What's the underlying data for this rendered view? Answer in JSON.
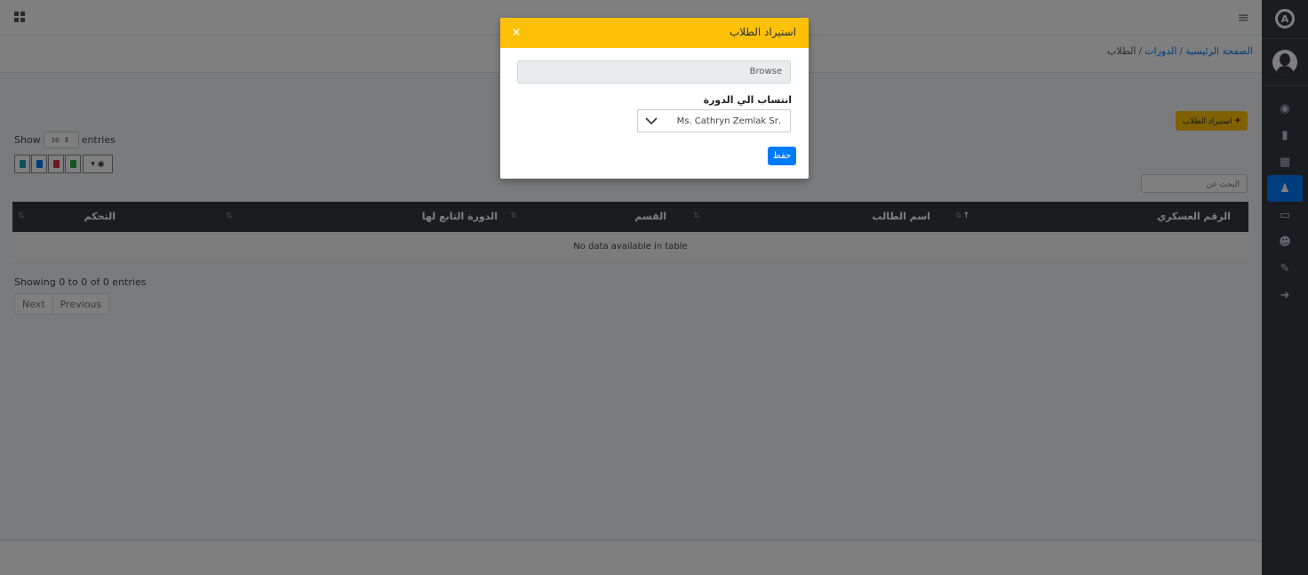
{
  "sidebar": {
    "logo_letter": "A",
    "items": [
      {
        "icon": "tachometer-icon",
        "glyph": "◉"
      },
      {
        "icon": "calendar-icon",
        "glyph": "▮"
      },
      {
        "icon": "th-icon",
        "glyph": "▦"
      },
      {
        "icon": "user-graduate-icon",
        "glyph": "♟"
      },
      {
        "icon": "chalkboard-teacher-icon",
        "glyph": "▭"
      },
      {
        "icon": "users-icon",
        "glyph": "☻"
      },
      {
        "icon": "wrench-icon",
        "glyph": "✎"
      },
      {
        "icon": "sign-out-icon",
        "glyph": "➜"
      }
    ]
  },
  "navbar": {
    "menu_glyph": "≡"
  },
  "breadcrumb": {
    "home": "الصفحة الرئيسية",
    "courses": "الدورات",
    "current": "الطلاب",
    "sep": "/"
  },
  "toolbar": {
    "import_plus": "+",
    "import_label": "استيراد الطلاب"
  },
  "table_controls": {
    "show": "Show",
    "length": "10",
    "entries": "entries",
    "search_placeholder": "البحث عن",
    "export_colors": [
      "#17a2b8",
      "#007bff",
      "#dc3545",
      "#28a745"
    ],
    "eye_glyph": "▾ ◉"
  },
  "table": {
    "columns": [
      "الرقم العسكري",
      "اسم الطالب",
      "القسم",
      "الدورة التابع لها",
      "التحكم"
    ],
    "empty": "No data available in table",
    "sort_up": "↑",
    "sort_both": "⇅"
  },
  "pagination": {
    "info": "Showing 0 to 0 of 0 entries",
    "next": "Next",
    "previous": "Previous"
  },
  "modal": {
    "title": "استيراد الطلاب",
    "close": "×",
    "file_label": "Browse",
    "course_label": "انتساب الي الدورة",
    "course_selected": ".Ms. Cathryn Zemlak Sr",
    "save": "حفظ"
  },
  "colors": {
    "warning": "#ffc107",
    "primary": "#007bff",
    "dark": "#343a40"
  }
}
